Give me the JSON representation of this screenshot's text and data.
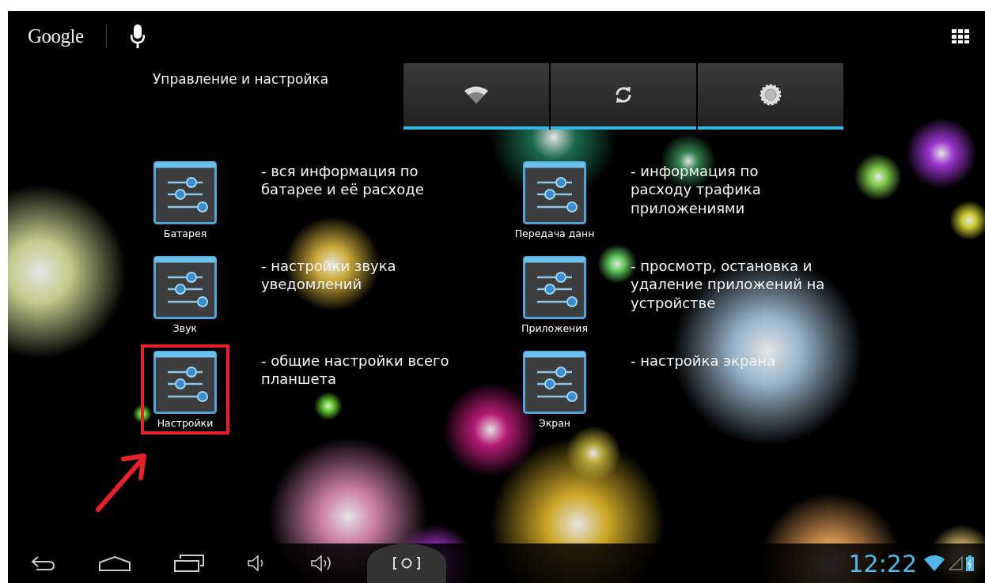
{
  "top_bar": {
    "search_logo": "Google"
  },
  "widget": {
    "title": "Управление и настройка",
    "toggles": [
      {
        "kind": "wifi",
        "on": true
      },
      {
        "kind": "sync",
        "on": true
      },
      {
        "kind": "brightness",
        "on": true
      }
    ]
  },
  "apps": [
    {
      "label": "Батарея",
      "description": "- вся информация по\nбатарее и её расходе",
      "highlighted": false
    },
    {
      "label": "Передача данн",
      "description": "- информация по\nрасходу трафика\nприложениями",
      "highlighted": false
    },
    {
      "label": "Звук",
      "description": "- настройки звука\nуведомлений",
      "highlighted": false
    },
    {
      "label": "Приложения",
      "description": "- просмотр, остановка и\nудаление приложений на\nустройстве",
      "highlighted": false
    },
    {
      "label": "Настройки",
      "description": "- общие настройки всего\nпланшета",
      "highlighted": true
    },
    {
      "label": "Экран",
      "description": "- настройка экрана",
      "highlighted": false
    }
  ],
  "nav_bar": {
    "buttons": [
      {
        "kind": "back"
      },
      {
        "kind": "home"
      },
      {
        "kind": "recents"
      },
      {
        "kind": "volume-down"
      },
      {
        "kind": "volume-up"
      },
      {
        "kind": "screenshot"
      }
    ]
  },
  "status": {
    "time": "12:22"
  }
}
